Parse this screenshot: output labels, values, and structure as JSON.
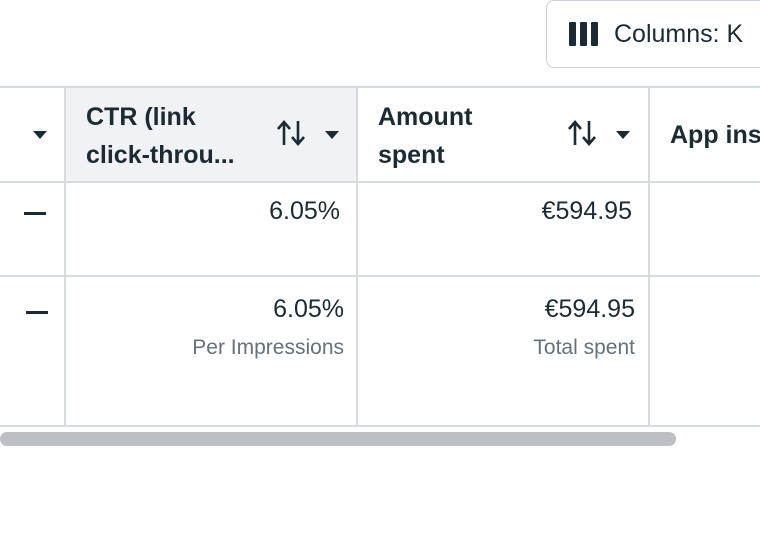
{
  "toolbar": {
    "columns_label": "Columns: K"
  },
  "table": {
    "headers": [
      {
        "line1": "CTR (link",
        "line2": "click-throu..."
      },
      {
        "line1": "Amount",
        "line2": "spent"
      },
      {
        "line1": "App ins",
        "line2": ""
      }
    ],
    "rows": [
      {
        "prev": "—",
        "ctr": "6.05%",
        "amount": "€594.95",
        "ctr_sub": "",
        "amount_sub": ""
      },
      {
        "prev": "—",
        "ctr": "6.05%",
        "amount": "€594.95",
        "ctr_sub": "Per Impressions",
        "amount_sub": "Total spent"
      }
    ]
  },
  "icons": {
    "sort": "sort-icon",
    "dropdown": "caret-down-icon",
    "columns": "columns-icon"
  }
}
